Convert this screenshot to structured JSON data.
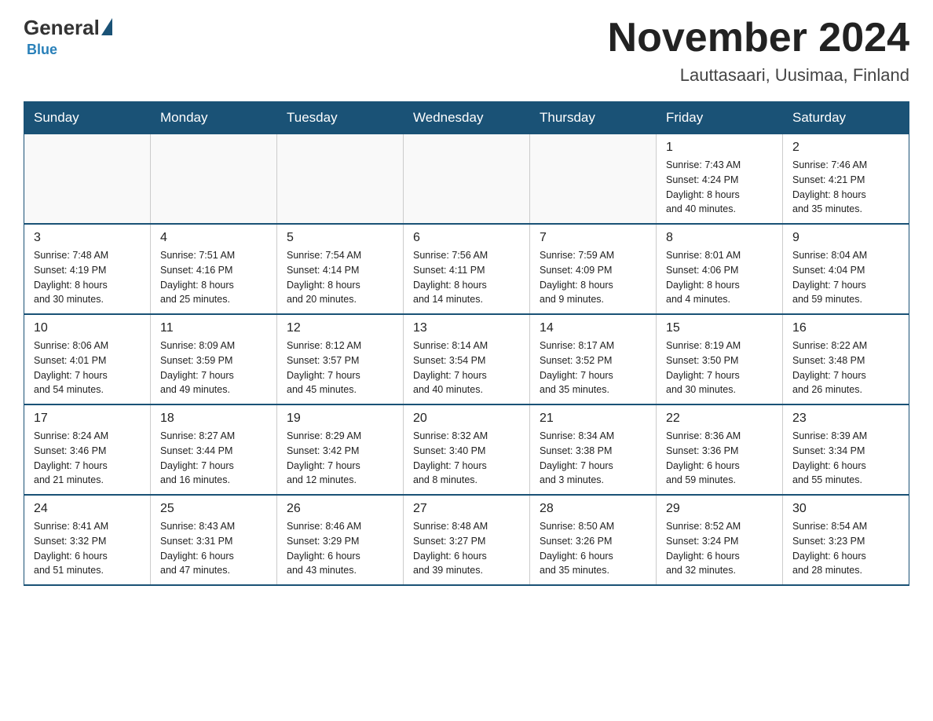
{
  "header": {
    "logo_general": "General",
    "logo_blue": "Blue",
    "month_title": "November 2024",
    "location": "Lauttasaari, Uusimaa, Finland"
  },
  "weekdays": [
    "Sunday",
    "Monday",
    "Tuesday",
    "Wednesday",
    "Thursday",
    "Friday",
    "Saturday"
  ],
  "weeks": [
    [
      {
        "day": "",
        "info": ""
      },
      {
        "day": "",
        "info": ""
      },
      {
        "day": "",
        "info": ""
      },
      {
        "day": "",
        "info": ""
      },
      {
        "day": "",
        "info": ""
      },
      {
        "day": "1",
        "info": "Sunrise: 7:43 AM\nSunset: 4:24 PM\nDaylight: 8 hours\nand 40 minutes."
      },
      {
        "day": "2",
        "info": "Sunrise: 7:46 AM\nSunset: 4:21 PM\nDaylight: 8 hours\nand 35 minutes."
      }
    ],
    [
      {
        "day": "3",
        "info": "Sunrise: 7:48 AM\nSunset: 4:19 PM\nDaylight: 8 hours\nand 30 minutes."
      },
      {
        "day": "4",
        "info": "Sunrise: 7:51 AM\nSunset: 4:16 PM\nDaylight: 8 hours\nand 25 minutes."
      },
      {
        "day": "5",
        "info": "Sunrise: 7:54 AM\nSunset: 4:14 PM\nDaylight: 8 hours\nand 20 minutes."
      },
      {
        "day": "6",
        "info": "Sunrise: 7:56 AM\nSunset: 4:11 PM\nDaylight: 8 hours\nand 14 minutes."
      },
      {
        "day": "7",
        "info": "Sunrise: 7:59 AM\nSunset: 4:09 PM\nDaylight: 8 hours\nand 9 minutes."
      },
      {
        "day": "8",
        "info": "Sunrise: 8:01 AM\nSunset: 4:06 PM\nDaylight: 8 hours\nand 4 minutes."
      },
      {
        "day": "9",
        "info": "Sunrise: 8:04 AM\nSunset: 4:04 PM\nDaylight: 7 hours\nand 59 minutes."
      }
    ],
    [
      {
        "day": "10",
        "info": "Sunrise: 8:06 AM\nSunset: 4:01 PM\nDaylight: 7 hours\nand 54 minutes."
      },
      {
        "day": "11",
        "info": "Sunrise: 8:09 AM\nSunset: 3:59 PM\nDaylight: 7 hours\nand 49 minutes."
      },
      {
        "day": "12",
        "info": "Sunrise: 8:12 AM\nSunset: 3:57 PM\nDaylight: 7 hours\nand 45 minutes."
      },
      {
        "day": "13",
        "info": "Sunrise: 8:14 AM\nSunset: 3:54 PM\nDaylight: 7 hours\nand 40 minutes."
      },
      {
        "day": "14",
        "info": "Sunrise: 8:17 AM\nSunset: 3:52 PM\nDaylight: 7 hours\nand 35 minutes."
      },
      {
        "day": "15",
        "info": "Sunrise: 8:19 AM\nSunset: 3:50 PM\nDaylight: 7 hours\nand 30 minutes."
      },
      {
        "day": "16",
        "info": "Sunrise: 8:22 AM\nSunset: 3:48 PM\nDaylight: 7 hours\nand 26 minutes."
      }
    ],
    [
      {
        "day": "17",
        "info": "Sunrise: 8:24 AM\nSunset: 3:46 PM\nDaylight: 7 hours\nand 21 minutes."
      },
      {
        "day": "18",
        "info": "Sunrise: 8:27 AM\nSunset: 3:44 PM\nDaylight: 7 hours\nand 16 minutes."
      },
      {
        "day": "19",
        "info": "Sunrise: 8:29 AM\nSunset: 3:42 PM\nDaylight: 7 hours\nand 12 minutes."
      },
      {
        "day": "20",
        "info": "Sunrise: 8:32 AM\nSunset: 3:40 PM\nDaylight: 7 hours\nand 8 minutes."
      },
      {
        "day": "21",
        "info": "Sunrise: 8:34 AM\nSunset: 3:38 PM\nDaylight: 7 hours\nand 3 minutes."
      },
      {
        "day": "22",
        "info": "Sunrise: 8:36 AM\nSunset: 3:36 PM\nDaylight: 6 hours\nand 59 minutes."
      },
      {
        "day": "23",
        "info": "Sunrise: 8:39 AM\nSunset: 3:34 PM\nDaylight: 6 hours\nand 55 minutes."
      }
    ],
    [
      {
        "day": "24",
        "info": "Sunrise: 8:41 AM\nSunset: 3:32 PM\nDaylight: 6 hours\nand 51 minutes."
      },
      {
        "day": "25",
        "info": "Sunrise: 8:43 AM\nSunset: 3:31 PM\nDaylight: 6 hours\nand 47 minutes."
      },
      {
        "day": "26",
        "info": "Sunrise: 8:46 AM\nSunset: 3:29 PM\nDaylight: 6 hours\nand 43 minutes."
      },
      {
        "day": "27",
        "info": "Sunrise: 8:48 AM\nSunset: 3:27 PM\nDaylight: 6 hours\nand 39 minutes."
      },
      {
        "day": "28",
        "info": "Sunrise: 8:50 AM\nSunset: 3:26 PM\nDaylight: 6 hours\nand 35 minutes."
      },
      {
        "day": "29",
        "info": "Sunrise: 8:52 AM\nSunset: 3:24 PM\nDaylight: 6 hours\nand 32 minutes."
      },
      {
        "day": "30",
        "info": "Sunrise: 8:54 AM\nSunset: 3:23 PM\nDaylight: 6 hours\nand 28 minutes."
      }
    ]
  ]
}
